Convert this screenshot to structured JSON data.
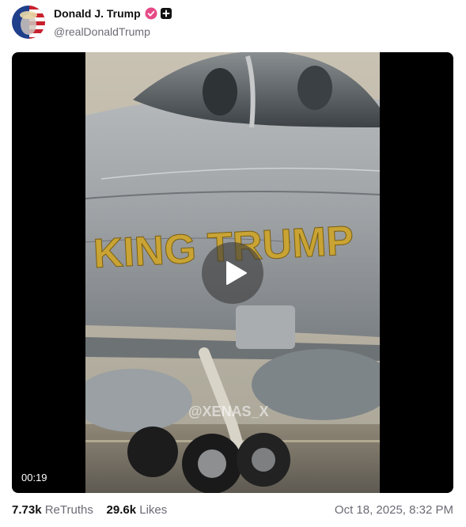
{
  "author": {
    "name": "Donald J. Trump",
    "handle": "@realDonaldTrump",
    "verified_color": "#e64a86"
  },
  "video": {
    "duration": "00:19",
    "aircraft_text": "KING TRUMP",
    "watermark": "@XENAS_X"
  },
  "stats": {
    "retruths_count": "7.73k",
    "retruths_label": "ReTruths",
    "likes_count": "29.6k",
    "likes_label": "Likes"
  },
  "timestamp": "Oct 18, 2025, 8:32 PM",
  "icons": [
    "avatar",
    "verified-badge-icon",
    "plus-badge-icon",
    "play-icon"
  ]
}
